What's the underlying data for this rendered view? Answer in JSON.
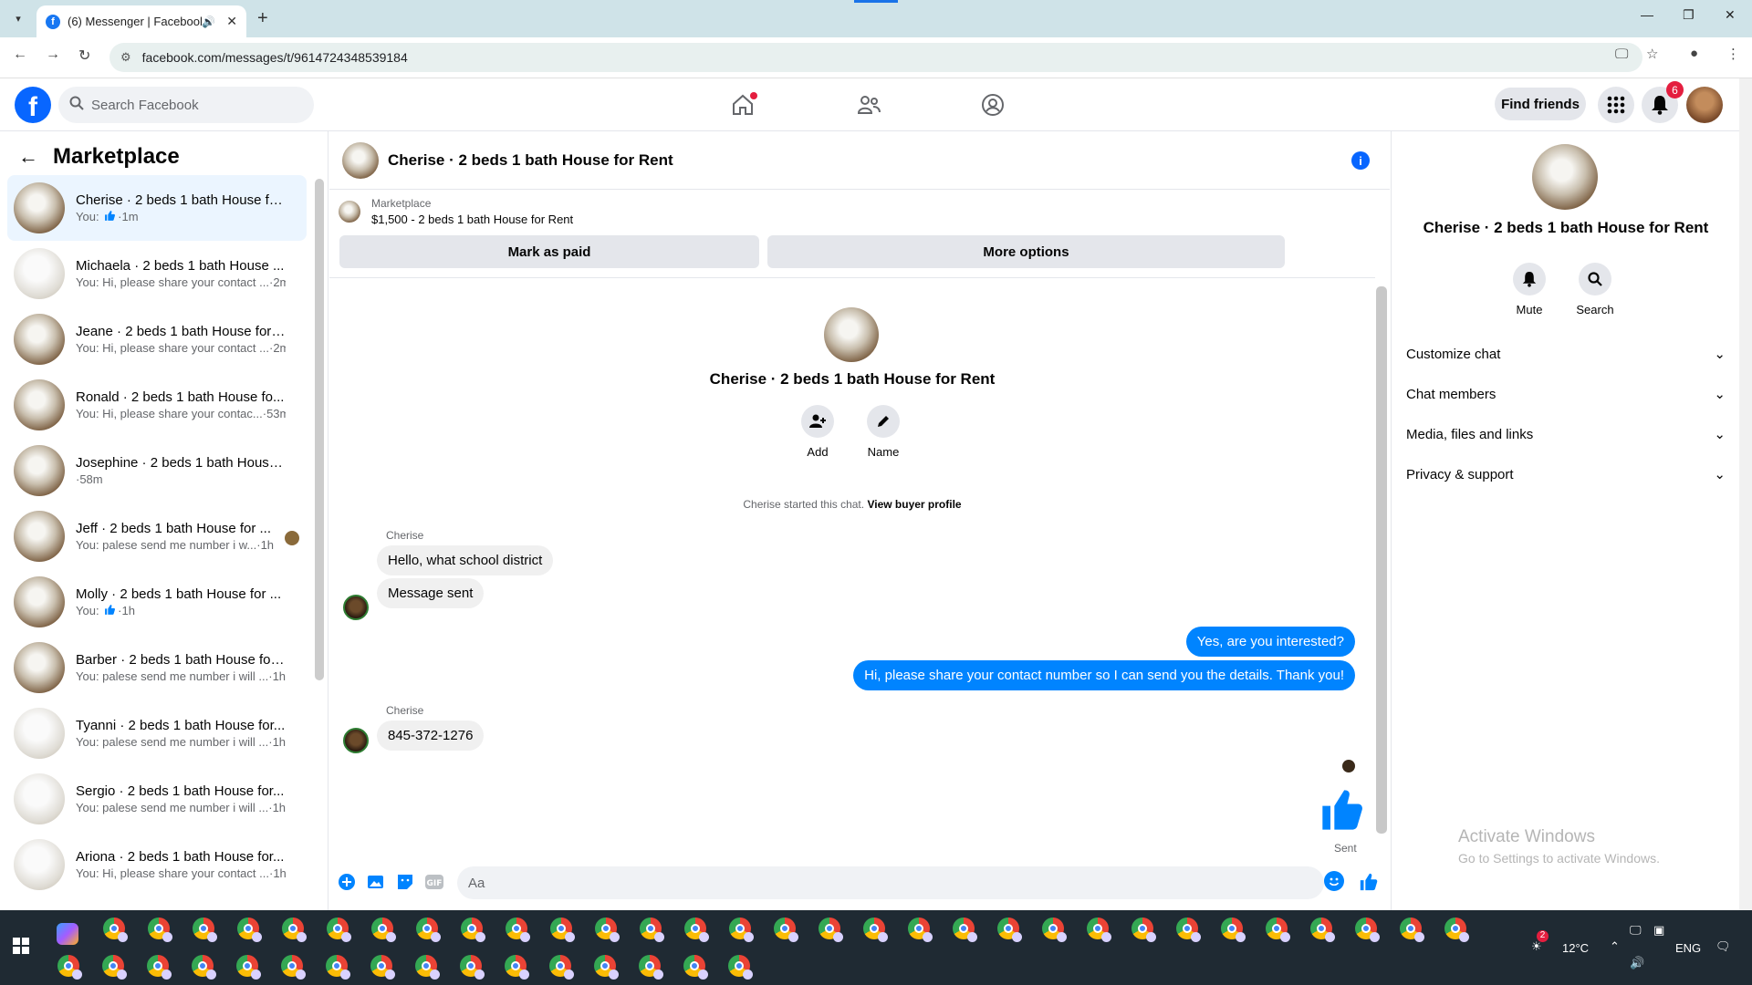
{
  "browser": {
    "tab_title": "(6) Messenger | Facebook",
    "url": "facebook.com/messages/t/9614724348539184"
  },
  "fb": {
    "search_placeholder": "Search Facebook",
    "find_friends": "Find friends",
    "notif_count": "6"
  },
  "left": {
    "title": "Marketplace",
    "conversations": [
      {
        "name": "Cherise · 2 beds 1 bath House fo...",
        "preview": "You: ",
        "time": "·1m",
        "thumb": true,
        "active": true
      },
      {
        "name": "Michaela · 2 beds 1 bath House ...",
        "preview": "You: Hi, please share your contact ...",
        "time": "·2m"
      },
      {
        "name": "Jeane · 2 beds 1 bath House for ...",
        "preview": "You: Hi, please share your contact ...",
        "time": "·2m"
      },
      {
        "name": "Ronald · 2 beds 1 bath House fo...",
        "preview": "You: Hi, please share your contac...",
        "time": "·53m"
      },
      {
        "name": "Josephine · 2 beds 1 bath House...",
        "preview": "",
        "time": "·58m"
      },
      {
        "name": "Jeff · 2 beds 1 bath House for ...",
        "preview": "You: palese send me number i w...",
        "time": "·1h",
        "seen": true
      },
      {
        "name": "Molly · 2 beds 1 bath House for ...",
        "preview": "You: ",
        "time": "·1h",
        "thumb": true
      },
      {
        "name": "Barber · 2 beds 1 bath House for...",
        "preview": "You: palese send me number i will ...",
        "time": "·1h"
      },
      {
        "name": "Tyanni · 2 beds 1 bath House for...",
        "preview": "You: palese send me number i will ...",
        "time": "·1h"
      },
      {
        "name": "Sergio · 2 beds 1 bath House for...",
        "preview": "You: palese send me number i will ...",
        "time": "·1h"
      },
      {
        "name": "Ariona · 2 beds 1 bath House for...",
        "preview": "You: Hi, please share your contact ...",
        "time": "·1h"
      }
    ]
  },
  "chat": {
    "title": "Cherise · 2 beds 1 bath House for Rent",
    "marketplace_label": "Marketplace",
    "listing": "$1,500 - 2 beds 1 bath House for Rent",
    "mark_paid": "Mark as paid",
    "more_options": "More options",
    "center_name": "Cherise · 2 beds 1 bath House for Rent",
    "add_label": "Add",
    "name_label": "Name",
    "started_text": "Cherise started this chat.",
    "view_buyer": "View buyer profile",
    "sender_name": "Cherise",
    "msg1": "Hello, what school district",
    "msg2": "Message sent",
    "out1": "Yes, are you interested?",
    "out2": "Hi, please share your contact number so I can send you the details. Thank you!",
    "msg3": "845-372-1276",
    "sent_label": "Sent",
    "composer_placeholder": "Aa"
  },
  "right": {
    "name": "Cherise · 2 beds 1 bath House for Rent",
    "mute": "Mute",
    "search": "Search",
    "sections": [
      "Customize chat",
      "Chat members",
      "Media, files and links",
      "Privacy & support"
    ]
  },
  "watermark": {
    "line1": "Activate Windows",
    "line2": "Go to Settings to activate Windows."
  },
  "taskbar": {
    "temp": "12°C",
    "lang": "ENG",
    "weather_badge": "2"
  },
  "colors": {
    "fb_blue": "#0866ff",
    "messenger_blue": "#0084ff",
    "active_row": "#ebf5ff"
  }
}
